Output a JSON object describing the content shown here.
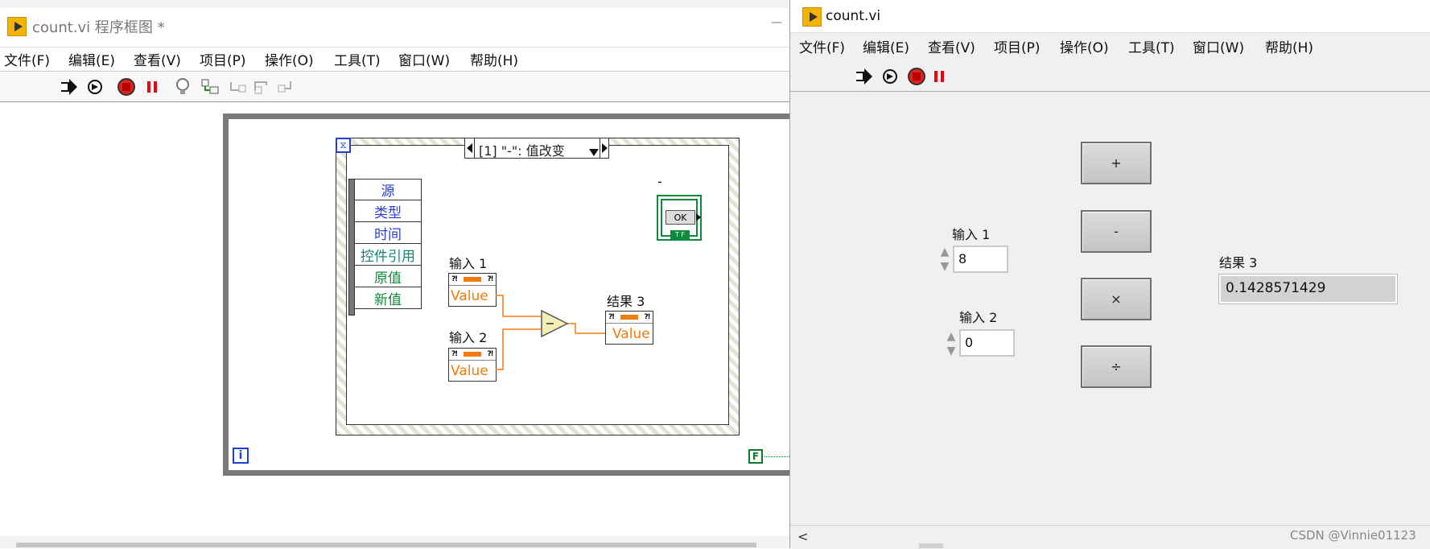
{
  "block_diagram": {
    "title": "count.vi 程序框图 *",
    "minimize": "—",
    "menu": [
      "文件(F)",
      "编辑(E)",
      "查看(V)",
      "项目(P)",
      "操作(O)",
      "工具(T)",
      "窗口(W)",
      "帮助(H)"
    ],
    "case_selector": "[1] \"-\": 值改变",
    "event_data": [
      "源",
      "类型",
      "时间",
      "控件引用",
      "原值",
      "新值"
    ],
    "input1_label": "输入 1",
    "input2_label": "输入 2",
    "result_label": "结果 3",
    "term_value": "Value",
    "button_label": "-",
    "ok_text": "OK",
    "tf_text": "T F",
    "loop_index": "i",
    "stop_text": "F",
    "case_icon": "⧖"
  },
  "front_panel": {
    "title": "count.vi",
    "menu": [
      "文件(F)",
      "编辑(E)",
      "查看(V)",
      "项目(P)",
      "操作(O)",
      "工具(T)",
      "窗口(W)",
      "帮助(H)"
    ],
    "buttons": [
      "+",
      "-",
      "×",
      "÷"
    ],
    "input1_label": "输入 1",
    "input1_value": "8",
    "input2_label": "输入 2",
    "input2_value": "0",
    "result_label": "结果 3",
    "result_value": "0.1428571429",
    "watermark": "CSDN @Vinnie01123",
    "scroll_left": "<"
  },
  "colors": {
    "orange_wire": "#f27b0c",
    "event_blue": "#2a3fd1",
    "event_green": "#0f8a3c",
    "loop_border": "#7a7a7a"
  }
}
